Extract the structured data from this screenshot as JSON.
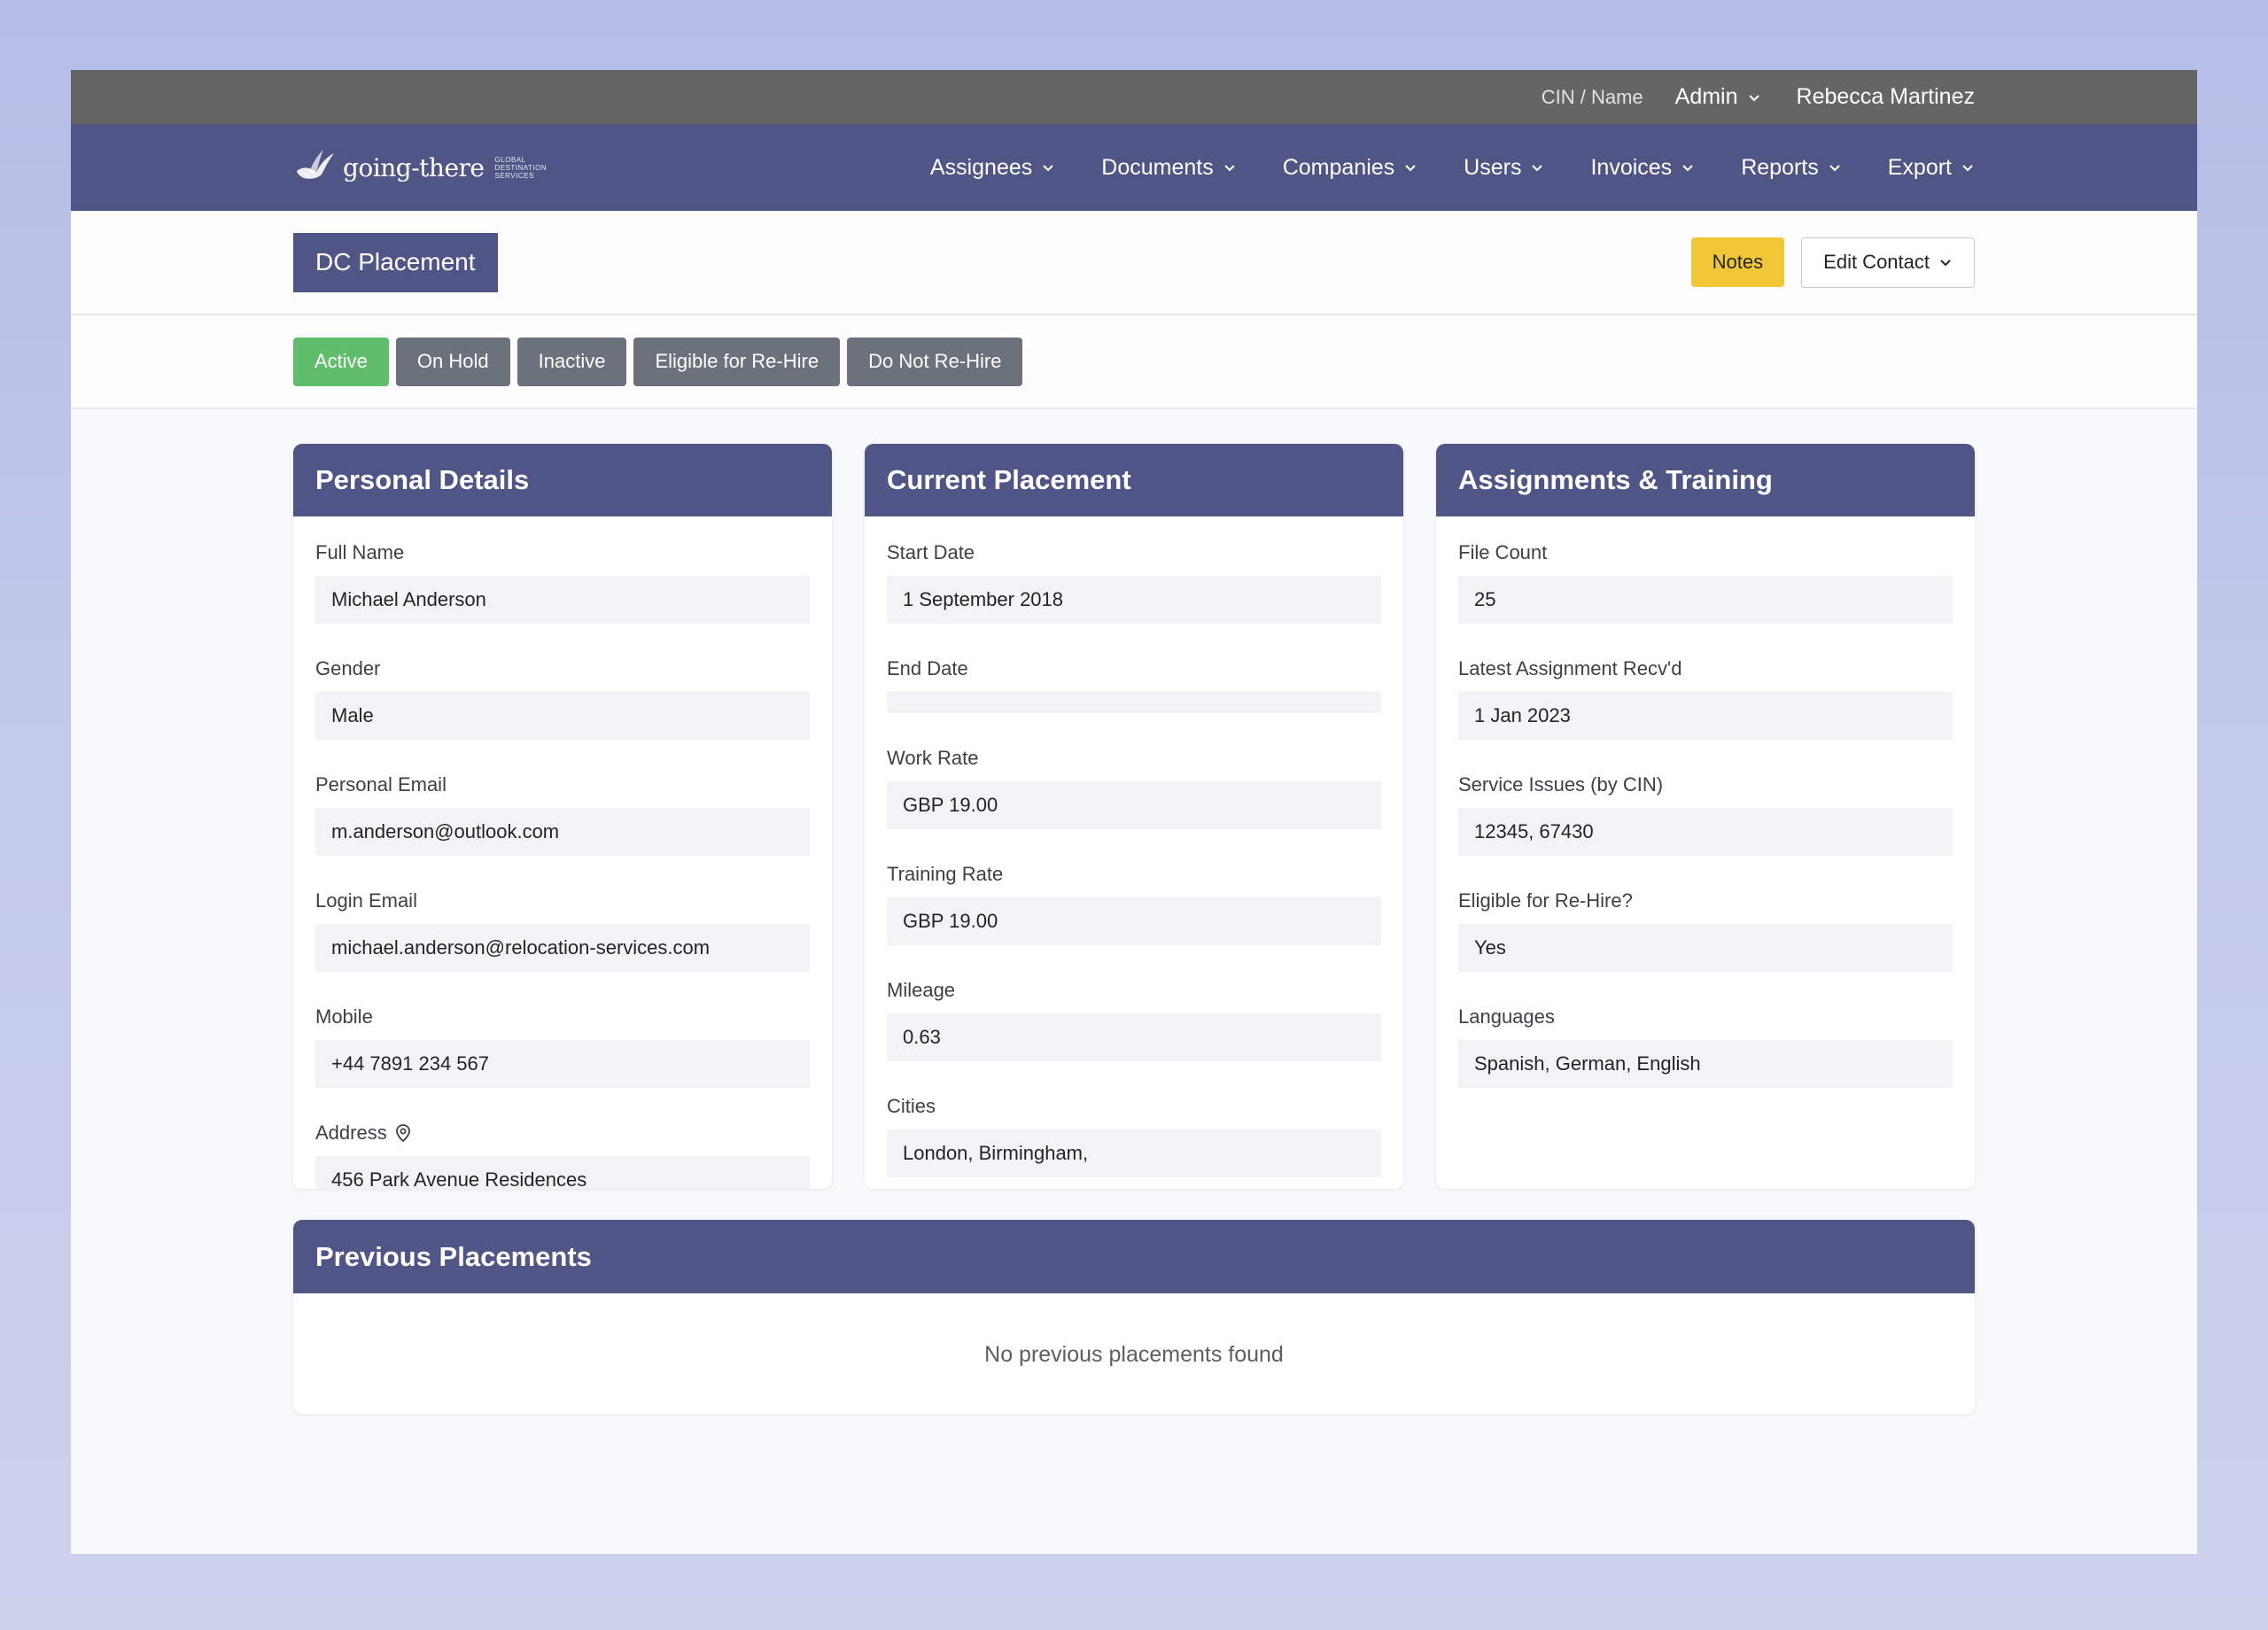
{
  "topbar": {
    "search_label": "CIN / Name",
    "admin_label": "Admin",
    "user_name": "Rebecca Martinez"
  },
  "brand": {
    "name": "going-there",
    "tagline": "Global Destination Services"
  },
  "nav": {
    "items": [
      {
        "label": "Assignees"
      },
      {
        "label": "Documents"
      },
      {
        "label": "Companies"
      },
      {
        "label": "Users"
      },
      {
        "label": "Invoices"
      },
      {
        "label": "Reports"
      },
      {
        "label": "Export"
      }
    ]
  },
  "header": {
    "title": "DC Placement",
    "notes_label": "Notes",
    "edit_contact_label": "Edit Contact"
  },
  "status": {
    "buttons": [
      {
        "label": "Active",
        "active": true
      },
      {
        "label": "On Hold"
      },
      {
        "label": "Inactive"
      },
      {
        "label": "Eligible for Re-Hire"
      },
      {
        "label": "Do Not Re-Hire"
      }
    ]
  },
  "personal": {
    "title": "Personal Details",
    "fields": [
      {
        "label": "Full Name",
        "value": "Michael Anderson"
      },
      {
        "label": "Gender",
        "value": "Male"
      },
      {
        "label": "Personal Email",
        "value": "m.anderson@outlook.com"
      },
      {
        "label": "Login Email",
        "value": "michael.anderson@relocation-services.com"
      },
      {
        "label": "Mobile",
        "value": "+44 7891 234 567"
      },
      {
        "label": "Address",
        "value": "456 Park Avenue Residences"
      }
    ]
  },
  "placement": {
    "title": "Current Placement",
    "fields": [
      {
        "label": "Start Date",
        "value": "1 September 2018"
      },
      {
        "label": "End Date",
        "value": ""
      },
      {
        "label": "Work Rate",
        "value": "GBP 19.00"
      },
      {
        "label": "Training Rate",
        "value": "GBP 19.00"
      },
      {
        "label": "Mileage",
        "value": "0.63"
      },
      {
        "label": "Cities",
        "value": "London, Birmingham,"
      }
    ]
  },
  "assignments": {
    "title": "Assignments & Training",
    "fields": [
      {
        "label": "File Count",
        "value": "25"
      },
      {
        "label": "Latest Assignment Recv'd",
        "value": "1 Jan 2023"
      },
      {
        "label": "Service Issues (by CIN)",
        "value": "12345, 67430"
      },
      {
        "label": "Eligible for Re-Hire?",
        "value": "Yes"
      },
      {
        "label": "Languages",
        "value": "Spanish, German, English"
      }
    ]
  },
  "previous": {
    "title": "Previous Placements",
    "empty_text": "No previous placements found"
  },
  "icons": {
    "chevron": "chevron-down-icon",
    "address": "map-pin-icon",
    "logo": "bird-logo-icon"
  },
  "colors": {
    "primary": "#4f5686",
    "topbar": "#656565",
    "active": "#5fbe6a",
    "status_default": "#6c727b",
    "notes": "#f2c737"
  }
}
